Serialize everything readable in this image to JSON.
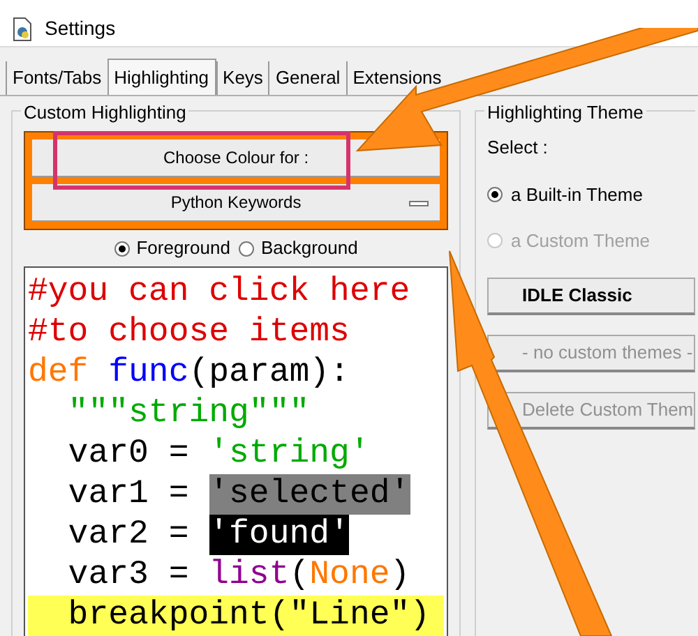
{
  "window": {
    "title": "Settings"
  },
  "tabs": [
    {
      "label": "Fonts/Tabs",
      "selected": false
    },
    {
      "label": "Highlighting",
      "selected": true
    },
    {
      "label": "Keys",
      "selected": false
    },
    {
      "label": "General",
      "selected": false
    },
    {
      "label": "Extensions",
      "selected": false
    }
  ],
  "custom_highlighting": {
    "title": "Custom Highlighting",
    "choose_button": "Choose Colour for :",
    "element_menu": "Python Keywords",
    "target": [
      {
        "label": "Foreground",
        "selected": true
      },
      {
        "label": "Background",
        "selected": false
      }
    ],
    "sample": [
      [
        {
          "text": "#you can click here",
          "kind": "comment"
        }
      ],
      [
        {
          "text": "#to choose items",
          "kind": "comment"
        }
      ],
      [
        {
          "text": "def",
          "kind": "keyword"
        },
        {
          "text": " func",
          "kind": "definition"
        },
        {
          "text": "(param):",
          "kind": "normal"
        }
      ],
      [
        {
          "text": "  \"\"\"string\"\"\"",
          "kind": "string"
        }
      ],
      [
        {
          "text": "  var0 = ",
          "kind": "normal"
        },
        {
          "text": "'string'",
          "kind": "string"
        }
      ],
      [
        {
          "text": "  var1 = ",
          "kind": "normal"
        },
        {
          "text": "'selected'",
          "kind": "selected"
        }
      ],
      [
        {
          "text": "  var2 = ",
          "kind": "normal"
        },
        {
          "text": "'found'",
          "kind": "found"
        }
      ],
      [
        {
          "text": "  var3 = ",
          "kind": "normal"
        },
        {
          "text": "list",
          "kind": "builtin"
        },
        {
          "text": "(",
          "kind": "normal"
        },
        {
          "text": "None",
          "kind": "keyword"
        },
        {
          "text": ")",
          "kind": "normal"
        }
      ],
      [
        {
          "text": "  breakpoint(\"Line\")",
          "kind": "breakpoint"
        }
      ]
    ]
  },
  "highlighting_theme": {
    "title": "Highlighting Theme",
    "select_label": "Select :",
    "options": [
      {
        "label": "a Built-in Theme",
        "selected": true,
        "disabled": false
      },
      {
        "label": "a Custom Theme",
        "selected": false,
        "disabled": true
      }
    ],
    "buttons": [
      {
        "label": "IDLE Classic",
        "disabled": false
      },
      {
        "label": "- no custom themes -",
        "disabled": true
      },
      {
        "label": "Delete Custom Them",
        "disabled": true
      }
    ]
  }
}
